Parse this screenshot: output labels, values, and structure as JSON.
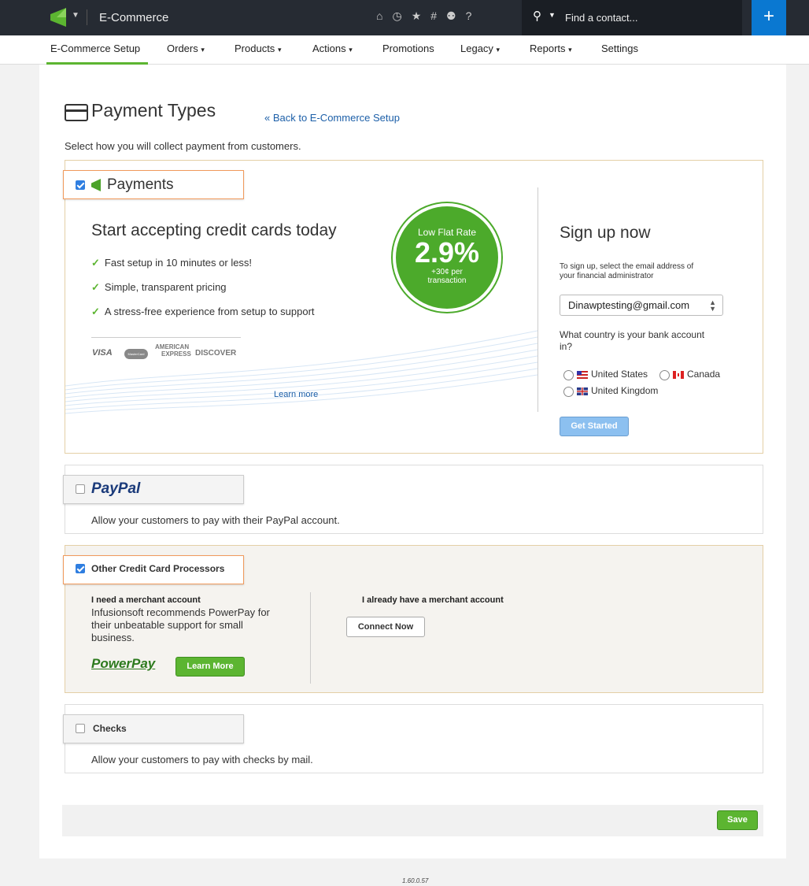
{
  "topbar": {
    "app_title": "E-Commerce",
    "search_placeholder": "Find a contact...",
    "plus_label": "+"
  },
  "nav": {
    "items": [
      "E-Commerce Setup",
      "Orders",
      "Products",
      "Actions",
      "Promotions",
      "Legacy",
      "Reports",
      "Settings"
    ],
    "caret": "⌄"
  },
  "page": {
    "title": "Payment Types",
    "back_link": "« Back to E-Commerce Setup",
    "description": "Select how you will collect payment from customers."
  },
  "payments": {
    "title": "Payments",
    "headline": "Start accepting credit cards today",
    "features": [
      "Fast setup in 10 minutes or less!",
      "Simple, transparent pricing",
      "A stress-free experience from setup to support"
    ],
    "card_logos": {
      "visa": "VISA",
      "mastercard": "MasterCard",
      "amex_line1": "AMERICAN",
      "amex_line2": "EXPRESS",
      "discover": "DISCOVER"
    },
    "rate": {
      "label": "Low Flat Rate",
      "value": "2.9%",
      "sub1": "+30¢ per",
      "sub2": "transaction"
    },
    "learn_more": "Learn more",
    "signup": {
      "title": "Sign up now",
      "instructions_1": "To sign up, select the email address of",
      "instructions_2": "your financial administrator",
      "email": "Dinawptesting@gmail.com",
      "country_question_1": "What country is your bank account",
      "country_question_2": "in?",
      "countries": [
        "United States",
        "Canada",
        "United Kingdom"
      ],
      "button": "Get Started"
    }
  },
  "paypal": {
    "title": "PayPal",
    "description": "Allow your customers to pay with their PayPal account."
  },
  "other_cc": {
    "title": "Other Credit Card Processors",
    "need_title": "I need a merchant account",
    "need_text": [
      "Infusionsoft recommends PowerPay for",
      "their unbeatable support for small",
      "business."
    ],
    "powerpay_logo": "PowerPay",
    "learn_more": "Learn More",
    "have_title": "I already have a merchant account",
    "connect": "Connect Now"
  },
  "checks": {
    "title": "Checks",
    "description": "Allow your customers to pay with checks by mail."
  },
  "save": "Save",
  "version": "1.60.0.57",
  "colors": {
    "accent_green": "#5cb531",
    "link_blue": "#1c5fa8",
    "topbar": "#262b33",
    "plus_blue": "#0a78d1"
  }
}
